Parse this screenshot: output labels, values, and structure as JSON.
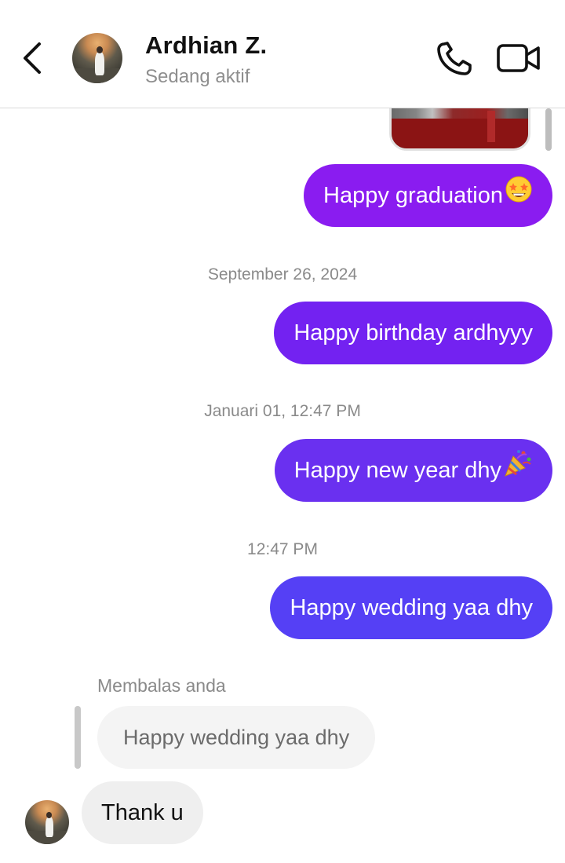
{
  "header": {
    "contact_name": "Ardhian Z.",
    "status": "Sedang aktif",
    "back_icon": "chevron-left-icon",
    "call_icon": "phone-icon",
    "video_icon": "video-camera-icon"
  },
  "messages": {
    "m1": {
      "text": "Happy graduation",
      "emoji_icon": "star-struck-emoji"
    },
    "ts1": "September 26, 2024",
    "m2": {
      "text": "Happy birthday ardhyyy"
    },
    "ts2": "Januari 01, 12:47 PM",
    "m3": {
      "text": "Happy new year dhy",
      "emoji_icon": "party-popper-emoji"
    },
    "ts3": "12:47 PM",
    "m4": {
      "text": "Happy wedding yaa dhy"
    }
  },
  "reply": {
    "label": "Membalas anda",
    "quoted_text": "Happy wedding yaa dhy",
    "incoming_text": "Thank u"
  },
  "colors": {
    "bubble_1": "#8a1cf0",
    "bubble_2": "#7322f1",
    "bubble_3": "#6a30f0",
    "bubble_4": "#5540f5",
    "incoming_bubble": "#efefef"
  }
}
